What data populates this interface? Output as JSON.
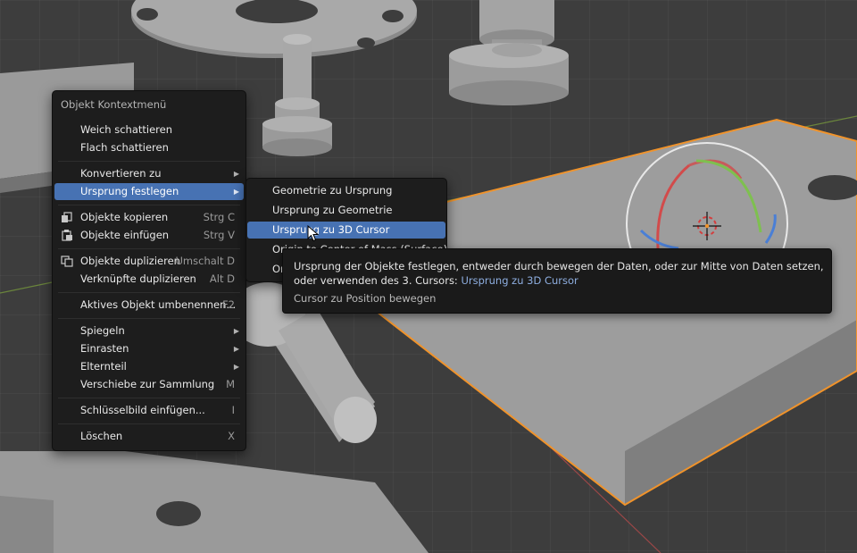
{
  "context_menu": {
    "title": "Objekt Kontextmenü",
    "items": [
      {
        "label": "Weich schattieren",
        "shortcut": ""
      },
      {
        "label": "Flach schattieren",
        "shortcut": ""
      },
      {
        "label": "Konvertieren zu",
        "shortcut": ""
      },
      {
        "label": "Ursprung festlegen",
        "shortcut": ""
      },
      {
        "label": "Objekte kopieren",
        "shortcut": "Strg C"
      },
      {
        "label": "Objekte einfügen",
        "shortcut": "Strg V"
      },
      {
        "label": "Objekte duplizieren",
        "shortcut": "Umschalt D"
      },
      {
        "label": "Verknüpfte duplizieren",
        "shortcut": "Alt D"
      },
      {
        "label": "Aktives Objekt umbenennen...",
        "shortcut": "F2"
      },
      {
        "label": "Spiegeln",
        "shortcut": ""
      },
      {
        "label": "Einrasten",
        "shortcut": ""
      },
      {
        "label": "Elternteil",
        "shortcut": ""
      },
      {
        "label": "Verschiebe zur Sammlung",
        "shortcut": "M"
      },
      {
        "label": "Schlüsselbild einfügen...",
        "shortcut": "I"
      },
      {
        "label": "Löschen",
        "shortcut": "X"
      }
    ]
  },
  "submenu": {
    "items": [
      {
        "label": "Geometrie zu Ursprung"
      },
      {
        "label": "Ursprung zu Geometrie"
      },
      {
        "label": "Ursprung zu 3D Cursor"
      },
      {
        "label": "Origin to Center of Mass (Surface)"
      },
      {
        "label": "Or"
      }
    ]
  },
  "tooltip": {
    "description": "Ursprung der Objekte festlegen, entweder durch bewegen der Daten, oder zur Mitte von Daten setzen, oder verwenden des 3. Cursors:",
    "python": "Ursprung zu 3D Cursor",
    "extra": "Cursor zu Position bewegen"
  },
  "colors": {
    "highlight": "#4772b3",
    "menu_bg": "#1d1d1d",
    "selection_outline": "#f0932b",
    "x_axis": "#b44a4a",
    "y_axis": "#7ea43c"
  },
  "icons": [
    "copy-objects-icon",
    "paste-objects-icon",
    "duplicate-objects-icon",
    "submenu-arrow-icon",
    "mouse-pointer-icon",
    "3d-cursor-icon",
    "rotate-gizmo-icon"
  ]
}
